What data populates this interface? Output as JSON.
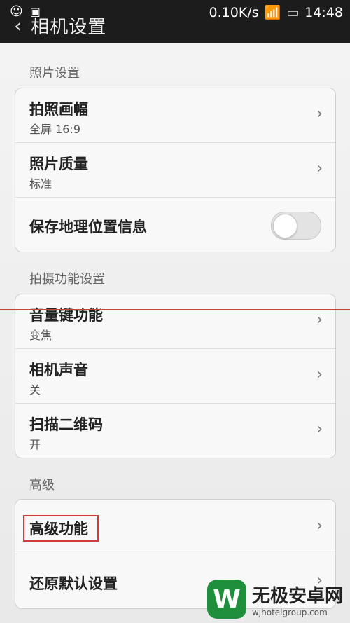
{
  "status_bar": {
    "speed": "0.10K/s",
    "time": "14:48",
    "icons": [
      "notification-icon",
      "image-icon",
      "wifi-icon",
      "signal-icon",
      "battery-icon"
    ]
  },
  "header": {
    "title": "相机设置",
    "back_icon": "back-arrow-icon"
  },
  "sections": [
    {
      "title": "照片设置",
      "items": [
        {
          "title": "拍照画幅",
          "subtitle": "全屏 16:9"
        },
        {
          "title": "照片质量",
          "subtitle": "标准"
        },
        {
          "title": "保存地理位置信息",
          "toggle": false
        }
      ]
    },
    {
      "title": "拍摄功能设置",
      "items": [
        {
          "title": "音量键功能",
          "subtitle": "变焦"
        },
        {
          "title": "相机声音",
          "subtitle": "关"
        },
        {
          "title": "扫描二维码",
          "subtitle": "开"
        }
      ]
    },
    {
      "title": "高级",
      "items": [
        {
          "title": "高级功能"
        },
        {
          "title": "还原默认设置"
        }
      ]
    }
  ],
  "watermark": {
    "logo_letter": "W",
    "name": "无极安卓网",
    "url": "wjhotelgroup.com"
  },
  "colors": {
    "statusbar": "#1c1c1c",
    "annotation_red": "#d23a3a",
    "watermark_green": "#1f8f3c"
  }
}
